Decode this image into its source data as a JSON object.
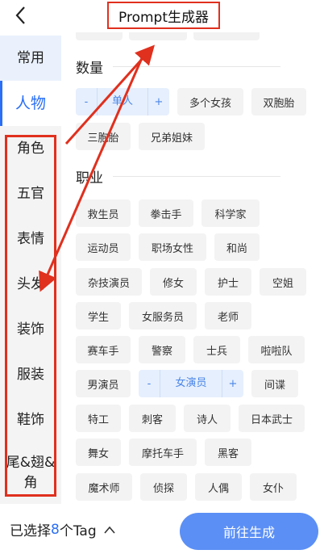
{
  "header": {
    "back_icon": "chevron-left-icon",
    "title": "Prompt生成器"
  },
  "sidebar": {
    "items": [
      {
        "label": "常用"
      },
      {
        "label": "人物"
      },
      {
        "label": "角色"
      },
      {
        "label": "五官"
      },
      {
        "label": "表情"
      },
      {
        "label": "头发"
      },
      {
        "label": "装饰"
      },
      {
        "label": "服装"
      },
      {
        "label": "鞋饰"
      },
      {
        "label": "尾&翅&角"
      }
    ],
    "active_index": 1
  },
  "sections": {
    "quantity": {
      "title": "数量",
      "stepper": {
        "minus": "-",
        "value": "单人",
        "plus": "+"
      },
      "tags": [
        "多个女孩",
        "双胞胎",
        "三胞胎",
        "兄弟姐妹"
      ]
    },
    "occupation": {
      "title": "职业",
      "row1": [
        "救生员",
        "拳击手",
        "科学家"
      ],
      "row2": [
        "运动员",
        "职场女性",
        "和尚"
      ],
      "row3": [
        "杂技演员",
        "修女",
        "护士",
        "空姐"
      ],
      "row4": [
        "学生",
        "女服务员",
        "老师"
      ],
      "row5": [
        "赛车手",
        "警察",
        "士兵",
        "啦啦队"
      ],
      "row6_tag": "男演员",
      "stepper": {
        "minus": "-",
        "value": "女演员",
        "plus": "+"
      },
      "row6_tag2": "间谍",
      "row7": [
        "特工",
        "刺客",
        "诗人",
        "日本武士"
      ],
      "row8": [
        "舞女",
        "摩托车手",
        "黑客"
      ],
      "row9": [
        "魔术师",
        "侦探",
        "人偶",
        "女仆"
      ]
    }
  },
  "footer": {
    "selected_prefix": "已选择",
    "selected_count": "8",
    "selected_suffix": "个Tag",
    "expand_icon": "chevron-up-icon",
    "generate_label": "前往生成"
  },
  "colors": {
    "accent": "#2a6ff5",
    "button": "#5b8ff5",
    "annotation": "#e0301e"
  }
}
